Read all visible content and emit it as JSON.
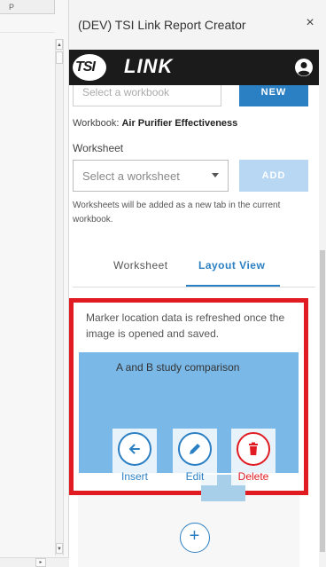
{
  "sheet": {
    "column_header": "P"
  },
  "pane": {
    "title": "(DEV) TSI Link Report Creator",
    "close_glyph": "×"
  },
  "brand": {
    "tsi": "TSI",
    "link": "LINK"
  },
  "workbook": {
    "select_placeholder": "Select a workbook",
    "new_label": "NEW",
    "label": "Workbook:",
    "name": "Air Purifier Effectiveness"
  },
  "worksheet": {
    "label": "Worksheet",
    "select_placeholder": "Select a worksheet",
    "add_label": "ADD",
    "hint": "Worksheets will be added as a new tab in the current workbook."
  },
  "tabs": {
    "worksheet": "Worksheet",
    "layout_view": "Layout View",
    "active": "layout_view"
  },
  "layout": {
    "note": "Marker location data is refreshed once the image is opened and saved.",
    "preview_title": "A and B study comparison",
    "actions": {
      "insert": "Insert",
      "edit": "Edit",
      "delete": "Delete"
    }
  },
  "add_layout": {
    "glyph": "+"
  },
  "colors": {
    "accent": "#2b7fc3",
    "danger": "#e11b22",
    "brand_dark": "#1b1b1b"
  },
  "icons": {
    "user": "user-circle-icon",
    "insert": "arrow-left-icon",
    "edit": "pencil-icon",
    "delete": "trash-icon",
    "add": "plus-icon"
  }
}
